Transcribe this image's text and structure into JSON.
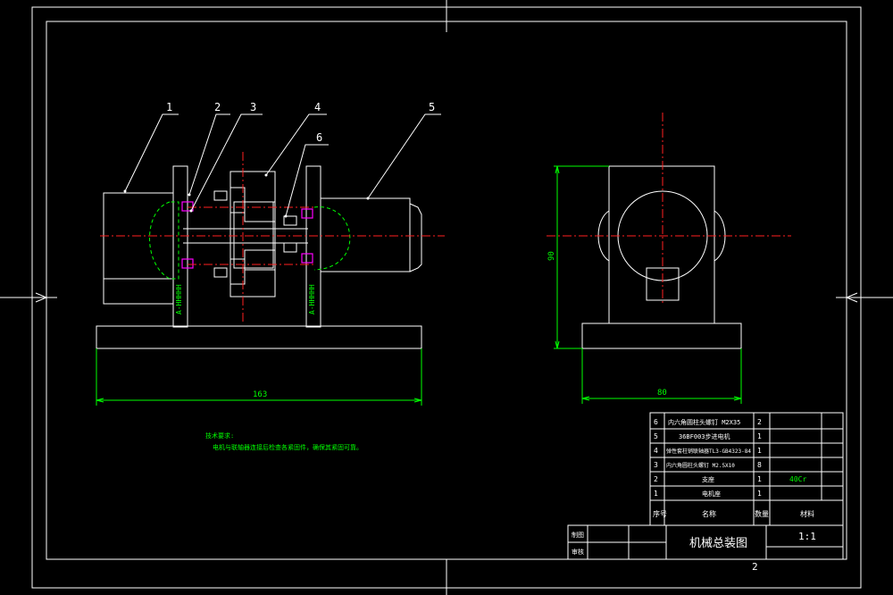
{
  "title_block": {
    "drawing_title": "机械总装图",
    "scale": "1:1",
    "sheet": "2",
    "row_labels": [
      "制图",
      "审核"
    ]
  },
  "bom": {
    "headers": [
      "序号",
      "名称",
      "数量",
      "材料"
    ],
    "rows": [
      {
        "no": "6",
        "name": "内六角圆柱头螺钉 M2X35",
        "qty": "2",
        "material": ""
      },
      {
        "no": "5",
        "name": "36BF003步进电机",
        "qty": "1",
        "material": ""
      },
      {
        "no": "4",
        "name": "弹性套柱销联轴器TL3-GB4323-84",
        "qty": "1",
        "material": ""
      },
      {
        "no": "3",
        "name": "内六角圆柱头螺钉 M2.5X10",
        "qty": "8",
        "material": ""
      },
      {
        "no": "2",
        "name": "支座",
        "qty": "1",
        "material": "40Cr"
      },
      {
        "no": "1",
        "name": "电机座",
        "qty": "1",
        "material": ""
      }
    ]
  },
  "dimensions": {
    "front_width": "163",
    "side_width": "80",
    "side_height": "90"
  },
  "balloons": [
    "1",
    "2",
    "3",
    "4",
    "5",
    "6"
  ],
  "notes": {
    "heading": "技术要求:",
    "line1": "电机与联轴器连接后检查各紧固件，确保其紧固可靠。"
  },
  "section_labels": {
    "left_face": "A-HHHHH",
    "right_face": "A-HHHHH"
  },
  "colors": {
    "line": "#ffffff",
    "dimension": "#00ff00",
    "centerline": "#ff2020",
    "bolt": "#ff00ff",
    "background": "#000000"
  }
}
